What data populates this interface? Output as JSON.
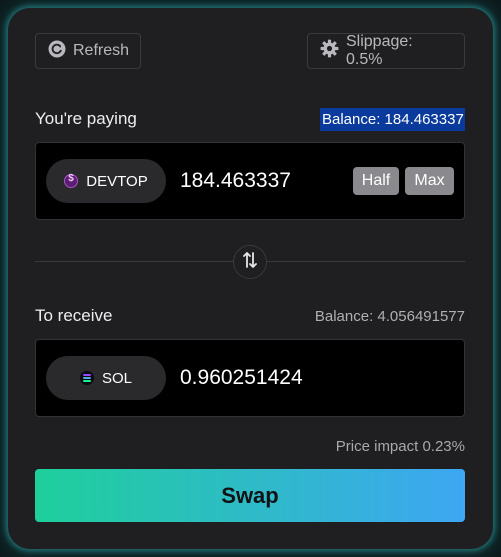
{
  "header": {
    "refresh_label": "Refresh",
    "slippage_label": "Slippage: 0.5%"
  },
  "pay": {
    "label": "You're paying",
    "balance": "Balance: 184.463337",
    "token": "DEVTOP",
    "amount": "184.463337",
    "half_label": "Half",
    "max_label": "Max"
  },
  "receive": {
    "label": "To receive",
    "balance": "Balance: 4.056491577",
    "token": "SOL",
    "amount": "0.960251424"
  },
  "price_impact": "Price impact 0.23%",
  "swap_label": "Swap",
  "icons": {
    "refresh": "refresh-icon",
    "slippage": "gear-icon",
    "switch": "swap-arrows-icon",
    "devtop": "devtop-coin-icon",
    "sol": "sol-coin-icon"
  },
  "colors": {
    "accent_start": "#1ecf9b",
    "accent_end": "#3ea6f2",
    "highlight": "#0a3a9c"
  }
}
